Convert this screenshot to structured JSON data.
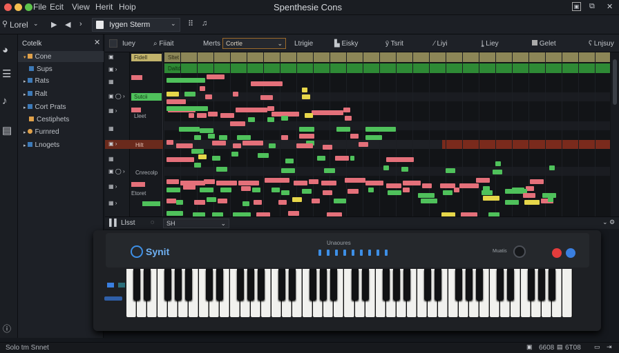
{
  "window": {
    "title": "Spenthesie Cons",
    "menu": [
      "File",
      "Ecit",
      "View",
      "Herit",
      "Hoip"
    ]
  },
  "toolbar": {
    "left_label": "Lorel",
    "dropdown_value": "Iygen Sterm"
  },
  "tracklist": {
    "header": "Cotelk",
    "items": [
      {
        "label": "Cone",
        "color": "#e0a14a"
      },
      {
        "label": "Sups",
        "color": "#3d7ab8"
      },
      {
        "label": "Rats",
        "color": "#3d7ab8"
      },
      {
        "label": "Ralt",
        "color": "#3d7ab8"
      },
      {
        "label": "Cort Prats",
        "color": "#3d7ab8"
      },
      {
        "label": "Cestiphets",
        "color": "#e0a14a"
      },
      {
        "label": "Furnred",
        "color": "#e0a14a"
      },
      {
        "label": "Lnogets",
        "color": "#3d7ab8"
      }
    ]
  },
  "editor": {
    "header": {
      "tab1": "Iuey",
      "tab2": "Fiiait",
      "tab3": "Merts",
      "select_value": "Cortle",
      "tab4": "Ltrigie",
      "tab5": "Eisky",
      "tab6": "Tsrit",
      "tab7": "Liyi",
      "tab8": "Liey",
      "tab9": "Gelet",
      "tab10": "Lnjsuy"
    },
    "track_labels": [
      "Fidell",
      "Sutcii",
      "Lleet",
      "Hilt",
      "Cnrecolp",
      "Etoret",
      "Sltet",
      "Daltd"
    ],
    "bottom": {
      "left": "Llsst",
      "select": "SH"
    }
  },
  "keyboard": {
    "brand": "Synit",
    "section_label": "Unaoures",
    "mini_label": "Muatis"
  },
  "status": {
    "left": "Solo tm Snnet",
    "r1": "6608",
    "r2": "6T08"
  },
  "colors": {
    "green": "#4fc15b",
    "pink": "#e4707a",
    "yellow": "#e6d64a",
    "dark_red": "#7a2a1c",
    "accent_blue": "#3d8fe6"
  }
}
